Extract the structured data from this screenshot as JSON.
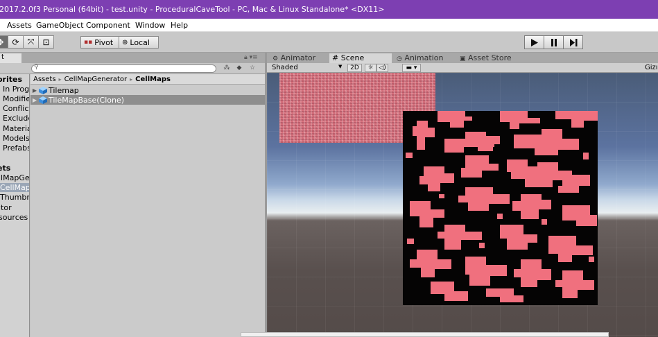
{
  "window": {
    "title": "2017.2.0f3 Personal (64bit) - test.unity - ProceduralCaveTool - PC, Mac & Linux Standalone* <DX11>"
  },
  "menu": {
    "items": [
      "Assets",
      "GameObject",
      "Component",
      "Window",
      "Help"
    ]
  },
  "toolbar": {
    "pivot_label": "Pivot",
    "local_label": "Local",
    "play_icon": "play-icon",
    "pause_icon": "pause-icon",
    "step_icon": "step-icon"
  },
  "project": {
    "tab_label": "t",
    "search": {
      "value": ""
    },
    "favorites": {
      "header": "orites",
      "items": [
        "In Prog",
        "Modifiec",
        "Conflict",
        "Exclude",
        "Materia",
        "Models",
        "Prefabs"
      ]
    },
    "assets": {
      "header": "ets",
      "items": [
        "llMapGe",
        "CellMap",
        "Thumbn",
        "itor",
        "sources"
      ]
    },
    "breadcrumb": [
      "Assets",
      "CellMapGenerator",
      "CellMaps"
    ],
    "files": [
      {
        "name": "Tilemap",
        "selected": false
      },
      {
        "name": "TileMapBase(Clone)",
        "selected": true
      }
    ]
  },
  "scene": {
    "tabs": [
      {
        "label": "Animator",
        "icon": "animator-icon",
        "active": false
      },
      {
        "label": "Scene",
        "icon": "scene-grid-icon",
        "active": true
      },
      {
        "label": "Animation",
        "icon": "animation-clock-icon",
        "active": false
      },
      {
        "label": "Asset Store",
        "icon": "store-icon",
        "active": false
      }
    ],
    "shading_mode": "Shaded",
    "mode_2d": "2D",
    "gizmos_label": "Gizı"
  },
  "colors": {
    "titlebar": "#7d3fb2",
    "cave_floor": "#050404",
    "cave_tile": "#f0707e",
    "selection": "#8e8e8e"
  }
}
